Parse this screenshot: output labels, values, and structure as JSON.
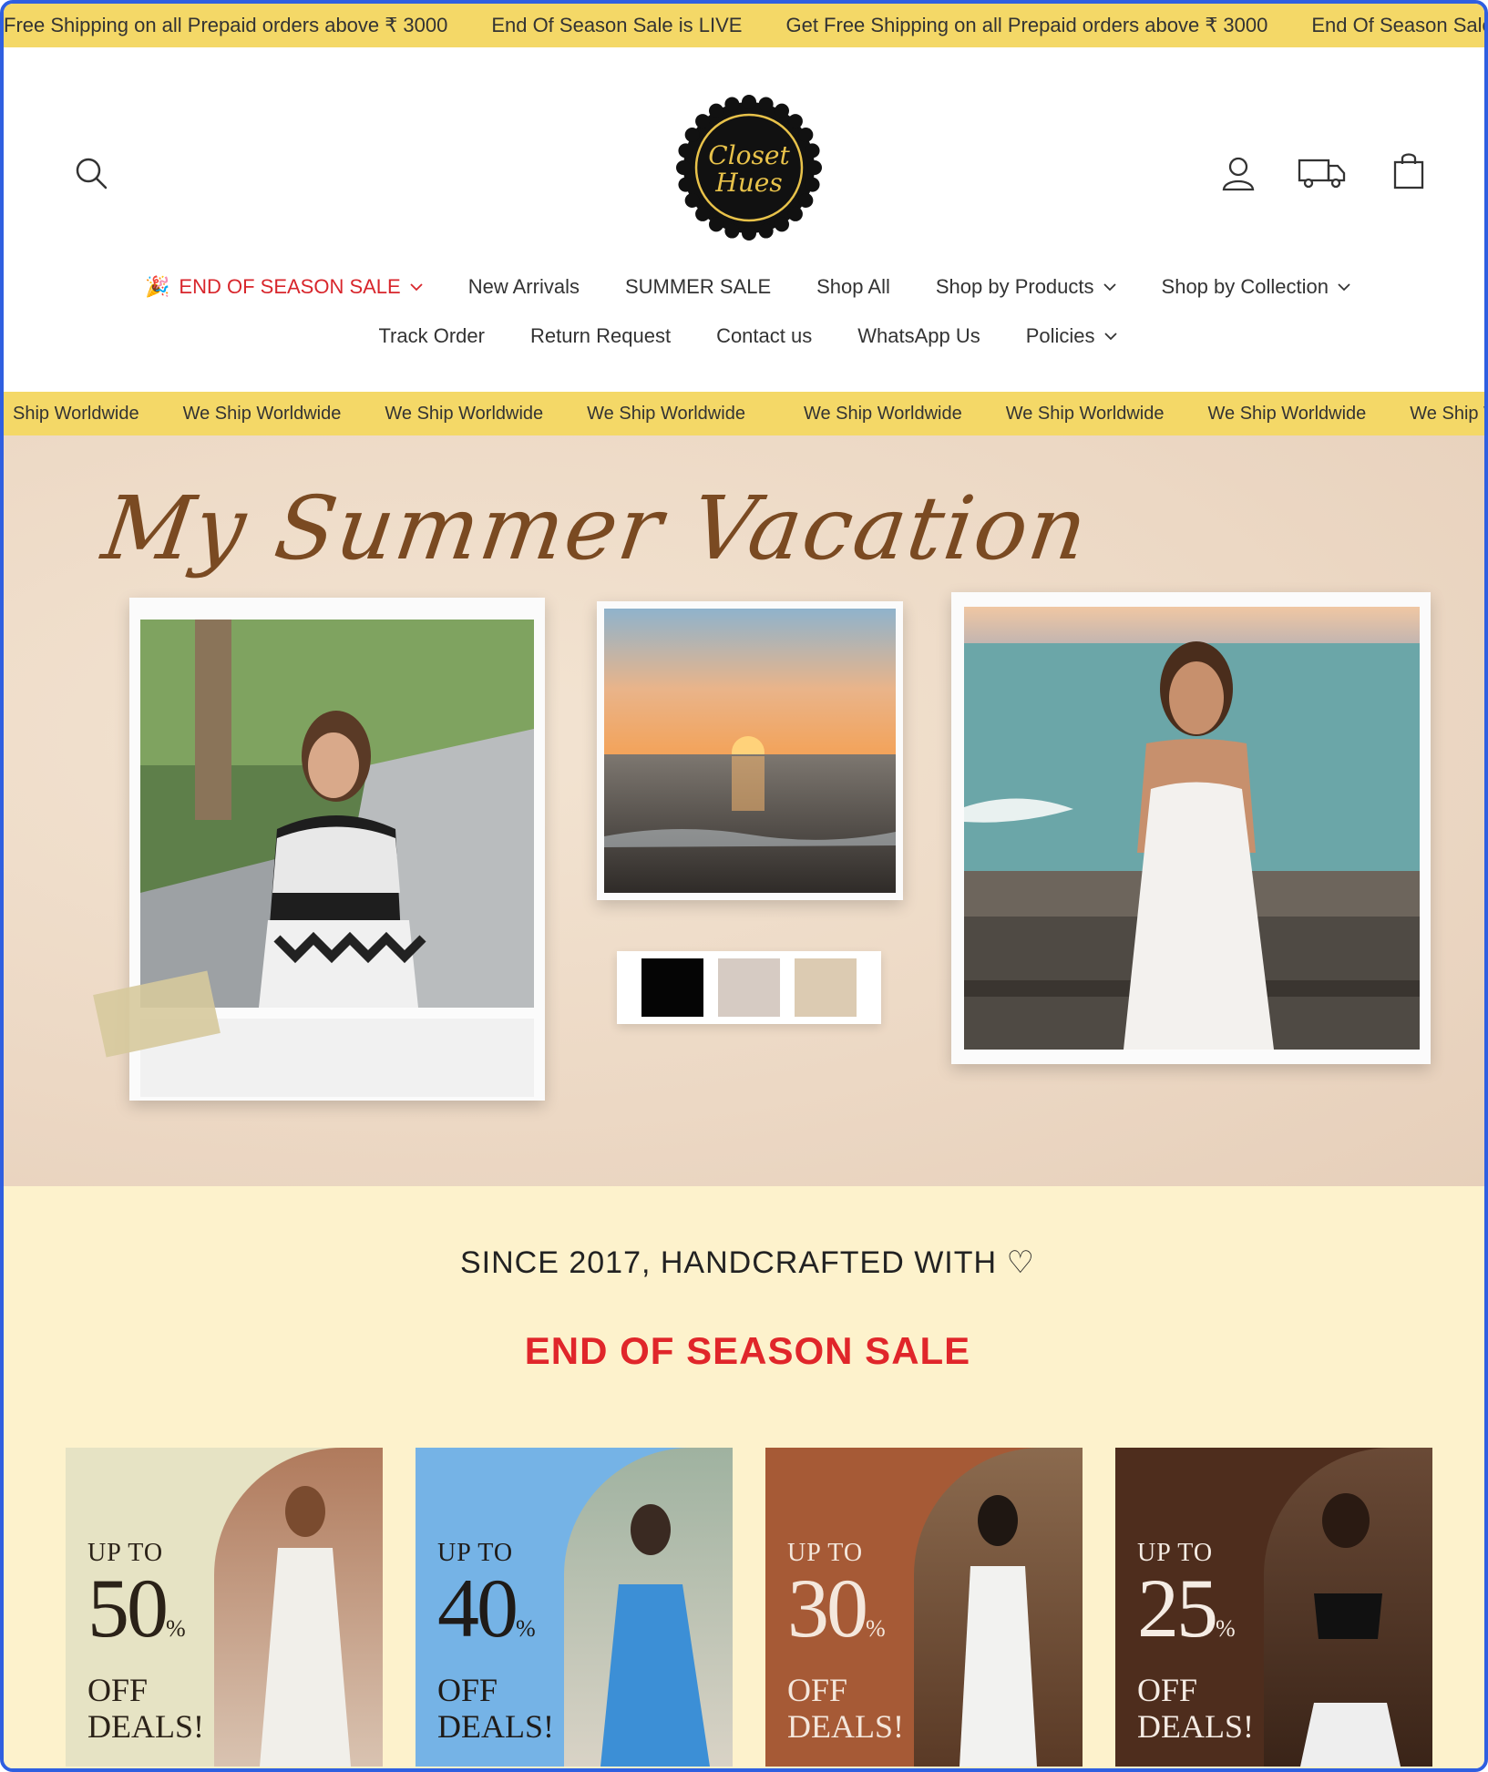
{
  "announcement": {
    "items": [
      "Free Shipping on all Prepaid orders above ₹ 3000",
      "End Of Season Sale is LIVE",
      "Get Free Shipping on all Prepaid orders above ₹ 3000",
      "End Of Season Sale is LIVE"
    ]
  },
  "header": {
    "logo_line1": "Closet",
    "logo_line2": "Hues",
    "icons": [
      "search-icon",
      "account-icon",
      "truck-icon",
      "bag-icon"
    ]
  },
  "nav": {
    "row1": [
      {
        "label": "END OF SEASON SALE",
        "dropdown": true,
        "emoji": "🎉"
      },
      {
        "label": "New Arrivals",
        "dropdown": false
      },
      {
        "label": "SUMMER SALE",
        "dropdown": false
      },
      {
        "label": "Shop All",
        "dropdown": false
      },
      {
        "label": "Shop by Products",
        "dropdown": true
      },
      {
        "label": "Shop by Collection",
        "dropdown": true
      }
    ],
    "row2": [
      {
        "label": "Track Order",
        "dropdown": false
      },
      {
        "label": "Return Request",
        "dropdown": false
      },
      {
        "label": "Contact us",
        "dropdown": false
      },
      {
        "label": "WhatsApp Us",
        "dropdown": false
      },
      {
        "label": "Policies",
        "dropdown": true
      }
    ]
  },
  "shipping_bar": {
    "items": [
      "Ship Worldwide",
      "We Ship Worldwide",
      "We Ship Worldwide",
      "We Ship Worldwide",
      "We Ship Worldwide",
      "We Ship Worldwide",
      "We Ship Worldwide",
      "We Ship Worldwide"
    ]
  },
  "hero": {
    "title": "My Summer Vacation",
    "swatch_colors": [
      "#050505",
      "#d6cbc3",
      "#dccbb2"
    ]
  },
  "section": {
    "tagline": "SINCE 2017, HANDCRAFTED WITH ♡",
    "sale_heading": "END OF SEASON SALE"
  },
  "deals": [
    {
      "upto": "UP TO",
      "percent": "50",
      "off": "OFF",
      "deals": "DEALS!",
      "bg": "#e6e3c4",
      "text": "#2b2218"
    },
    {
      "upto": "UP TO",
      "percent": "40",
      "off": "OFF",
      "deals": "DEALS!",
      "bg": "#75b3e6",
      "text": "#1f1b18"
    },
    {
      "upto": "UP TO",
      "percent": "30",
      "off": "OFF",
      "deals": "DEALS!",
      "bg": "#a65a36",
      "text": "#f4e7dc"
    },
    {
      "upto": "UP TO",
      "percent": "25",
      "off": "OFF",
      "deals": "DEALS!",
      "bg": "#4e2d1d",
      "text": "#f5ece4"
    }
  ]
}
